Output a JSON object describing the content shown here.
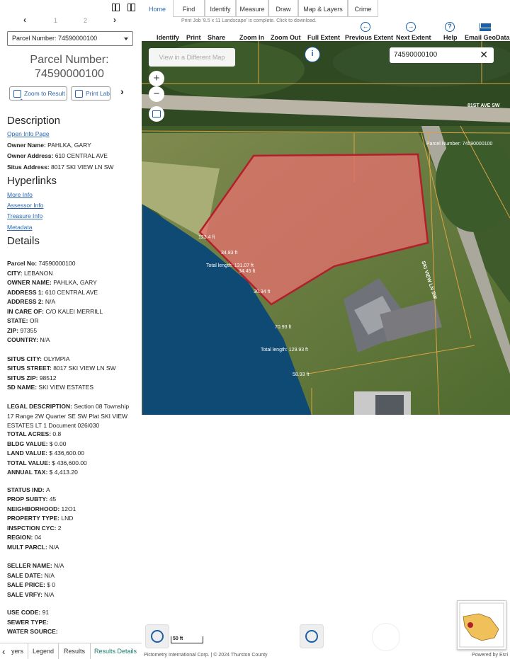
{
  "pager": {
    "prev": "‹",
    "page1": "1",
    "page2": "2",
    "next": "›"
  },
  "parcel_select": {
    "value": "Parcel Number: 74590000100"
  },
  "parcel_heading": {
    "line1": "Parcel Number:",
    "line2": "74590000100"
  },
  "actions": {
    "zoom": "Zoom to Result",
    "print": "Print Label",
    "more": "›"
  },
  "description": {
    "title": "Description",
    "link": "Open Info Page",
    "owner_name_label": "Owner Name:",
    "owner_name": "PAHLKA, GARY",
    "owner_address_label": "Owner Address:",
    "owner_address": "610 CENTRAL AVE",
    "situs_address_label": "Situs Address:",
    "situs_address": "8017 SKI VIEW LN SW"
  },
  "hyperlinks": {
    "title": "Hyperlinks",
    "items": [
      "More Info",
      "Assessor Info",
      "Treasure Info",
      "Metadata"
    ]
  },
  "details": {
    "title": "Details",
    "rows": [
      [
        "Parcel No",
        "74590000100"
      ],
      [
        "CITY",
        "LEBANON"
      ],
      [
        "OWNER NAME",
        "PAHLKA, GARY"
      ],
      [
        "ADDRESS 1",
        "610 CENTRAL AVE"
      ],
      [
        "ADDRESS 2",
        "N/A"
      ],
      [
        "IN CARE OF",
        "C/O KALEI MERRILL"
      ],
      [
        "STATE",
        "OR"
      ],
      [
        "ZIP",
        "97355"
      ],
      [
        "COUNTRY",
        "N/A"
      ],
      [
        "SITUS CITY",
        "OLYMPIA"
      ],
      [
        "SITUS STREET",
        "8017 SKI VIEW LN SW"
      ],
      [
        "SITUS ZIP",
        "98512"
      ],
      [
        "SD NAME",
        "SKI VIEW ESTATES"
      ],
      [
        "TOTAL ACRES",
        "0.8"
      ],
      [
        "BLDG VALUE",
        "$ 0.00"
      ],
      [
        "LAND VALUE",
        "$ 436,600.00"
      ],
      [
        "TOTAL VALUE",
        "$ 436,600.00"
      ],
      [
        "ANNUAL TAX",
        "$ 4,413.20"
      ],
      [
        "STATUS IND",
        "A"
      ],
      [
        "PROP SUBTY",
        "45"
      ],
      [
        "NEIGHBORHOOD",
        "12O1"
      ],
      [
        "PROPERTY TYPE",
        "LND"
      ],
      [
        "INSPCTION CYC",
        "2"
      ],
      [
        "REGION",
        "04"
      ],
      [
        "MULT PARCL",
        "N/A"
      ],
      [
        "SELLER NAME",
        "N/A"
      ],
      [
        "SALE DATE",
        "N/A"
      ],
      [
        "SALE PRICE",
        "$ 0"
      ],
      [
        "SALE VRFY",
        "N/A"
      ],
      [
        "USE CODE",
        "91"
      ],
      [
        "SEWER TYPE",
        ""
      ],
      [
        "WATER SOURCE",
        ""
      ]
    ],
    "legal_label": "LEGAL DESCRIPTION:",
    "legal_value": "Section 08  Township 17  Range 2W  Quarter SE SW   Plat   SKI VIEW ESTATES   LT   1  Document 026/030"
  },
  "bottom_tabs": [
    "yers",
    "Legend",
    "Results",
    "Results Details"
  ],
  "nav_tabs": [
    "Home",
    "Find",
    "Identify",
    "Measure",
    "Draw",
    "Map & Layers",
    "Crime"
  ],
  "print_message": "Print Job '8.5 x 11 Landscape' is complete. Click to download.",
  "toolbar": [
    "Identify",
    "Print",
    "Share",
    "Zoom In",
    "Zoom Out",
    "Full Extent",
    "Previous Extent",
    "Next Extent",
    "Help",
    "Email GeoData"
  ],
  "map": {
    "view_different": "View in a Different Map",
    "search_value": "74590000100",
    "zoom_in": "+",
    "zoom_out": "−",
    "road_81st": "81ST AVE SW",
    "road_skiview": "SKI VIEW LN SW",
    "parcel_label": "Parcel Number: 74590000100",
    "dims": [
      "123.4 ft",
      "34.83 ft",
      "34.45 ft",
      "30.34 ft",
      "70.93 ft",
      "58.93 ft"
    ],
    "total1": "Total length: 131.07 ft",
    "total2": "Total length: 129.93 ft",
    "colors": {
      "parcel_fill": "#e8706f",
      "parcel_stroke": "#b21f2b",
      "line": "#d9a441",
      "water": "#0e4a73"
    }
  },
  "scale": "50 ft",
  "attribution": "Pictometry International Corp. | © 2024 Thurston County",
  "powered": "Powered by Esri"
}
